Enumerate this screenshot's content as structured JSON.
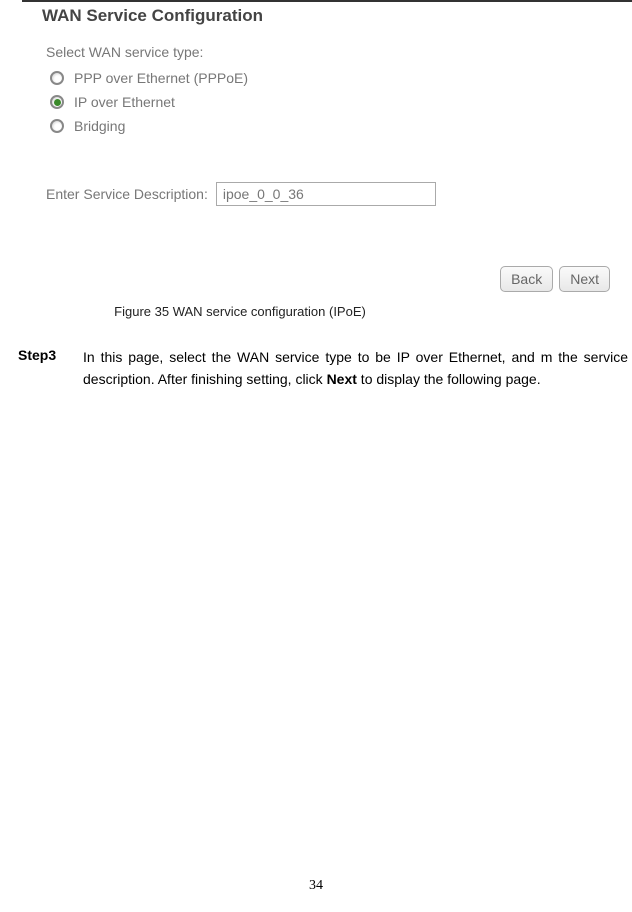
{
  "panel": {
    "title": "WAN Service Configuration",
    "select_label": "Select WAN service type:",
    "options": {
      "pppoe": "PPP over Ethernet (PPPoE)",
      "ipoe": "IP over Ethernet",
      "bridging": "Bridging"
    },
    "desc_label": "Enter Service Description:",
    "desc_value": "ipoe_0_0_36",
    "buttons": {
      "back": "Back",
      "next": "Next"
    }
  },
  "figure_caption": "Figure 35 WAN service configuration (IPoE)",
  "step": {
    "label": "Step3",
    "text_pre": "In this page, select the WAN service type to be IP over Ethernet, and m the service description. After finishing setting, click ",
    "bold": "Next",
    "text_post": " to display the following page."
  },
  "page_number": "34"
}
